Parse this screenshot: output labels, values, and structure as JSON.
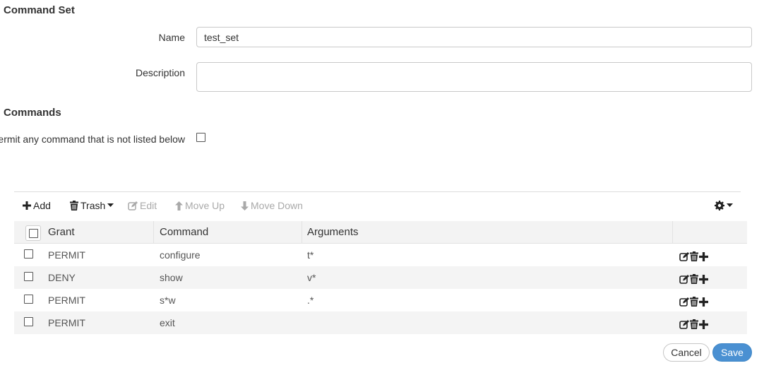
{
  "sections": {
    "command_set_title": "Command Set",
    "commands_title": "Commands"
  },
  "form": {
    "name_label": "Name",
    "name_value": "test_set",
    "description_label": "Description",
    "description_value": "",
    "permit_label": "Permit any command that is not listed below",
    "permit_checked": false
  },
  "toolbar": {
    "add_label": "Add",
    "trash_label": "Trash",
    "edit_label": "Edit",
    "move_up_label": "Move Up",
    "move_down_label": "Move Down"
  },
  "table": {
    "columns": [
      "Grant",
      "Command",
      "Arguments"
    ],
    "rows": [
      {
        "grant": "PERMIT",
        "command": "configure",
        "arguments": "t*"
      },
      {
        "grant": "DENY",
        "command": "show",
        "arguments": "v*"
      },
      {
        "grant": "PERMIT",
        "command": "s*w",
        "arguments": ".*"
      },
      {
        "grant": "PERMIT",
        "command": "exit",
        "arguments": ""
      }
    ],
    "row_action_icons": [
      "edit-icon",
      "trash-icon",
      "plus-icon"
    ]
  },
  "footer": {
    "cancel_label": "Cancel",
    "save_label": "Save"
  },
  "colors": {
    "save_button": "#4a90d2",
    "disabled_text": "#a9a9a9",
    "alt_row": "#f4f4f4"
  }
}
